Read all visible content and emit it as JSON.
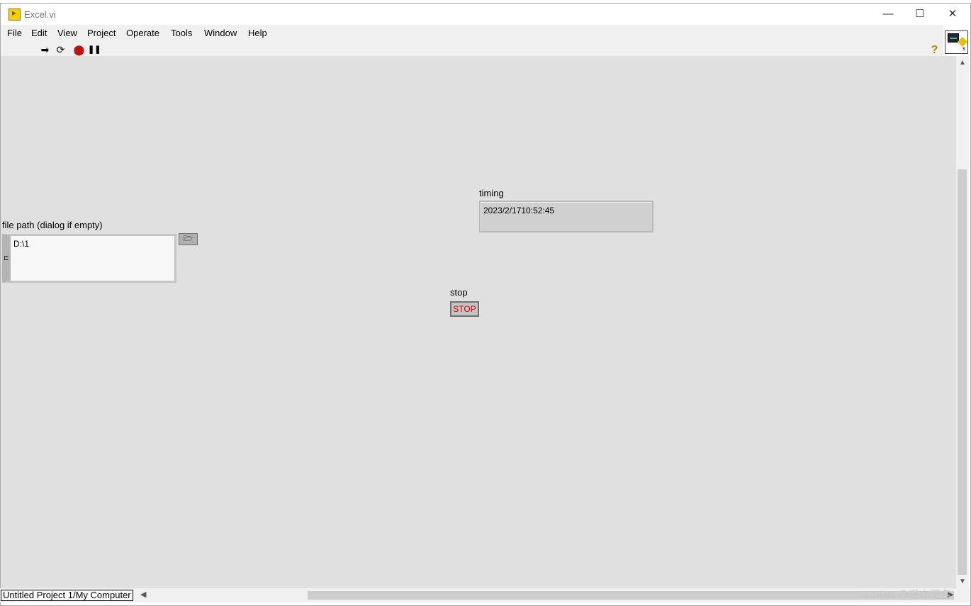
{
  "window": {
    "title": "Excel.vi",
    "minimize_glyph": "—",
    "maximize_glyph": "☐",
    "close_glyph": "✕"
  },
  "menu": [
    "File",
    "Edit",
    "View",
    "Project",
    "Operate",
    "Tools",
    "Window",
    "Help"
  ],
  "toolbar": {
    "run_glyph": "➡",
    "run_continuous_glyph": "⟳",
    "abort_glyph": "⬤",
    "pause_glyph": "❚❚",
    "help_glyph": "?"
  },
  "controls": {
    "file_path": {
      "label": "file path (dialog if empty)",
      "value": "D:\\1",
      "browse_glyph": "🗁"
    },
    "timing": {
      "label": "timing",
      "value": "2023/2/1710:52:45"
    },
    "stop": {
      "label": "stop",
      "button_text": "STOP"
    }
  },
  "statusbar": {
    "project": "Untitled Project 1/My Computer"
  },
  "watermark": "CSDN @道亦无名",
  "colors": {
    "panel_bg": "#e0e0e0",
    "stop_text": "#e00000",
    "vi_icon_accent": "#e8c000"
  }
}
